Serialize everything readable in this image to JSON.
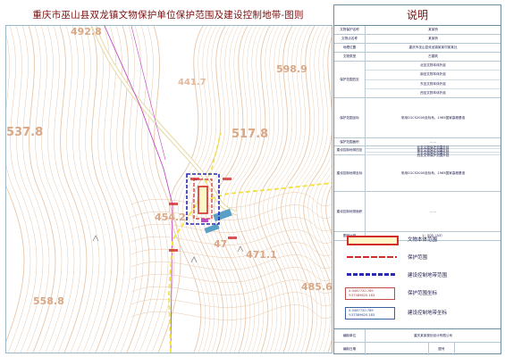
{
  "title": "重庆市巫山县双龙镇文物保护单位保护范围及建设控制地带-图则",
  "panel": {
    "heading": "说明",
    "rows": [
      {
        "key": "文物保护名称",
        "values": [
          "某某桥"
        ]
      },
      {
        "key": "文物点名称",
        "values": [
          "某某桥"
        ]
      },
      {
        "key": "地理位置",
        "values": [
          "重庆市巫山县双龙镇某某村某某社"
        ]
      },
      {
        "key": "文物类型",
        "values": [
          "古建筑"
        ]
      },
      {
        "key": "保护范围四至",
        "values": [
          "北至文物本体外延",
          "南至文物本体外延",
          "东至文物本体外延",
          "西至文物本体外延"
        ]
      },
      {
        "key": "保护范围坐标",
        "values": [
          "采用CGCS2000坐标系，1985国家高程基准"
        ]
      },
      {
        "key": "保护范围面积",
        "values": [
          "……"
        ]
      },
      {
        "key": "建设控制地带四至",
        "values": [
          "北至文物保护范围外延",
          "南至文物保护范围外延",
          "东至文物保护范围外延",
          "西至文物保护范围外延"
        ]
      },
      {
        "key": "建设控制地带坐标",
        "values": [
          "采用CGCS2000坐标系，1985国家高程基准"
        ]
      },
      {
        "key": "建设控制地带面积",
        "values": [
          "……"
        ]
      },
      {
        "key": "图纸比例",
        "values": [
          "1：500（A3）"
        ]
      }
    ],
    "legend": [
      {
        "kind": "body",
        "label": "文物本体范围"
      },
      {
        "kind": "protect",
        "label": "保护范围"
      },
      {
        "kind": "control",
        "label": "建设控制地带范围"
      },
      {
        "kind": "protect-coord",
        "label": "保护范围坐标",
        "coord": [
          "X:3467720.789",
          "Y:37389620.183"
        ]
      },
      {
        "kind": "control-coord",
        "label": "建设控制地带坐标",
        "coord": [
          "X:3467720.789",
          "Y:37389620.183"
        ]
      }
    ],
    "footer": [
      {
        "key": "编制单位",
        "value": "重庆某某规划设计有限公司"
      },
      {
        "key": "编制日期",
        "value": "",
        "key2": "图号",
        "value2": ""
      }
    ]
  },
  "map": {
    "elevations": [
      {
        "label": "492.8",
        "size": 11
      },
      {
        "label": "598.9",
        "size": 11
      },
      {
        "label": "537.8",
        "size": 13
      },
      {
        "label": "517.8",
        "size": 13
      },
      {
        "label": "454.2",
        "size": 11
      },
      {
        "label": "471.1",
        "size": 11
      },
      {
        "label": "485.6",
        "size": 11
      },
      {
        "label": "558.8",
        "size": 11
      },
      {
        "label": "441.7",
        "size": 10
      },
      {
        "label": "47",
        "size": 11
      }
    ],
    "colors": {
      "contour": "#e8c7a9",
      "road": "#e6d9a4",
      "magenta": "#c04bc0",
      "blueDash": "#2a2ab8",
      "redBody": "#d12b2b",
      "yellow": "#f2e23a"
    }
  }
}
